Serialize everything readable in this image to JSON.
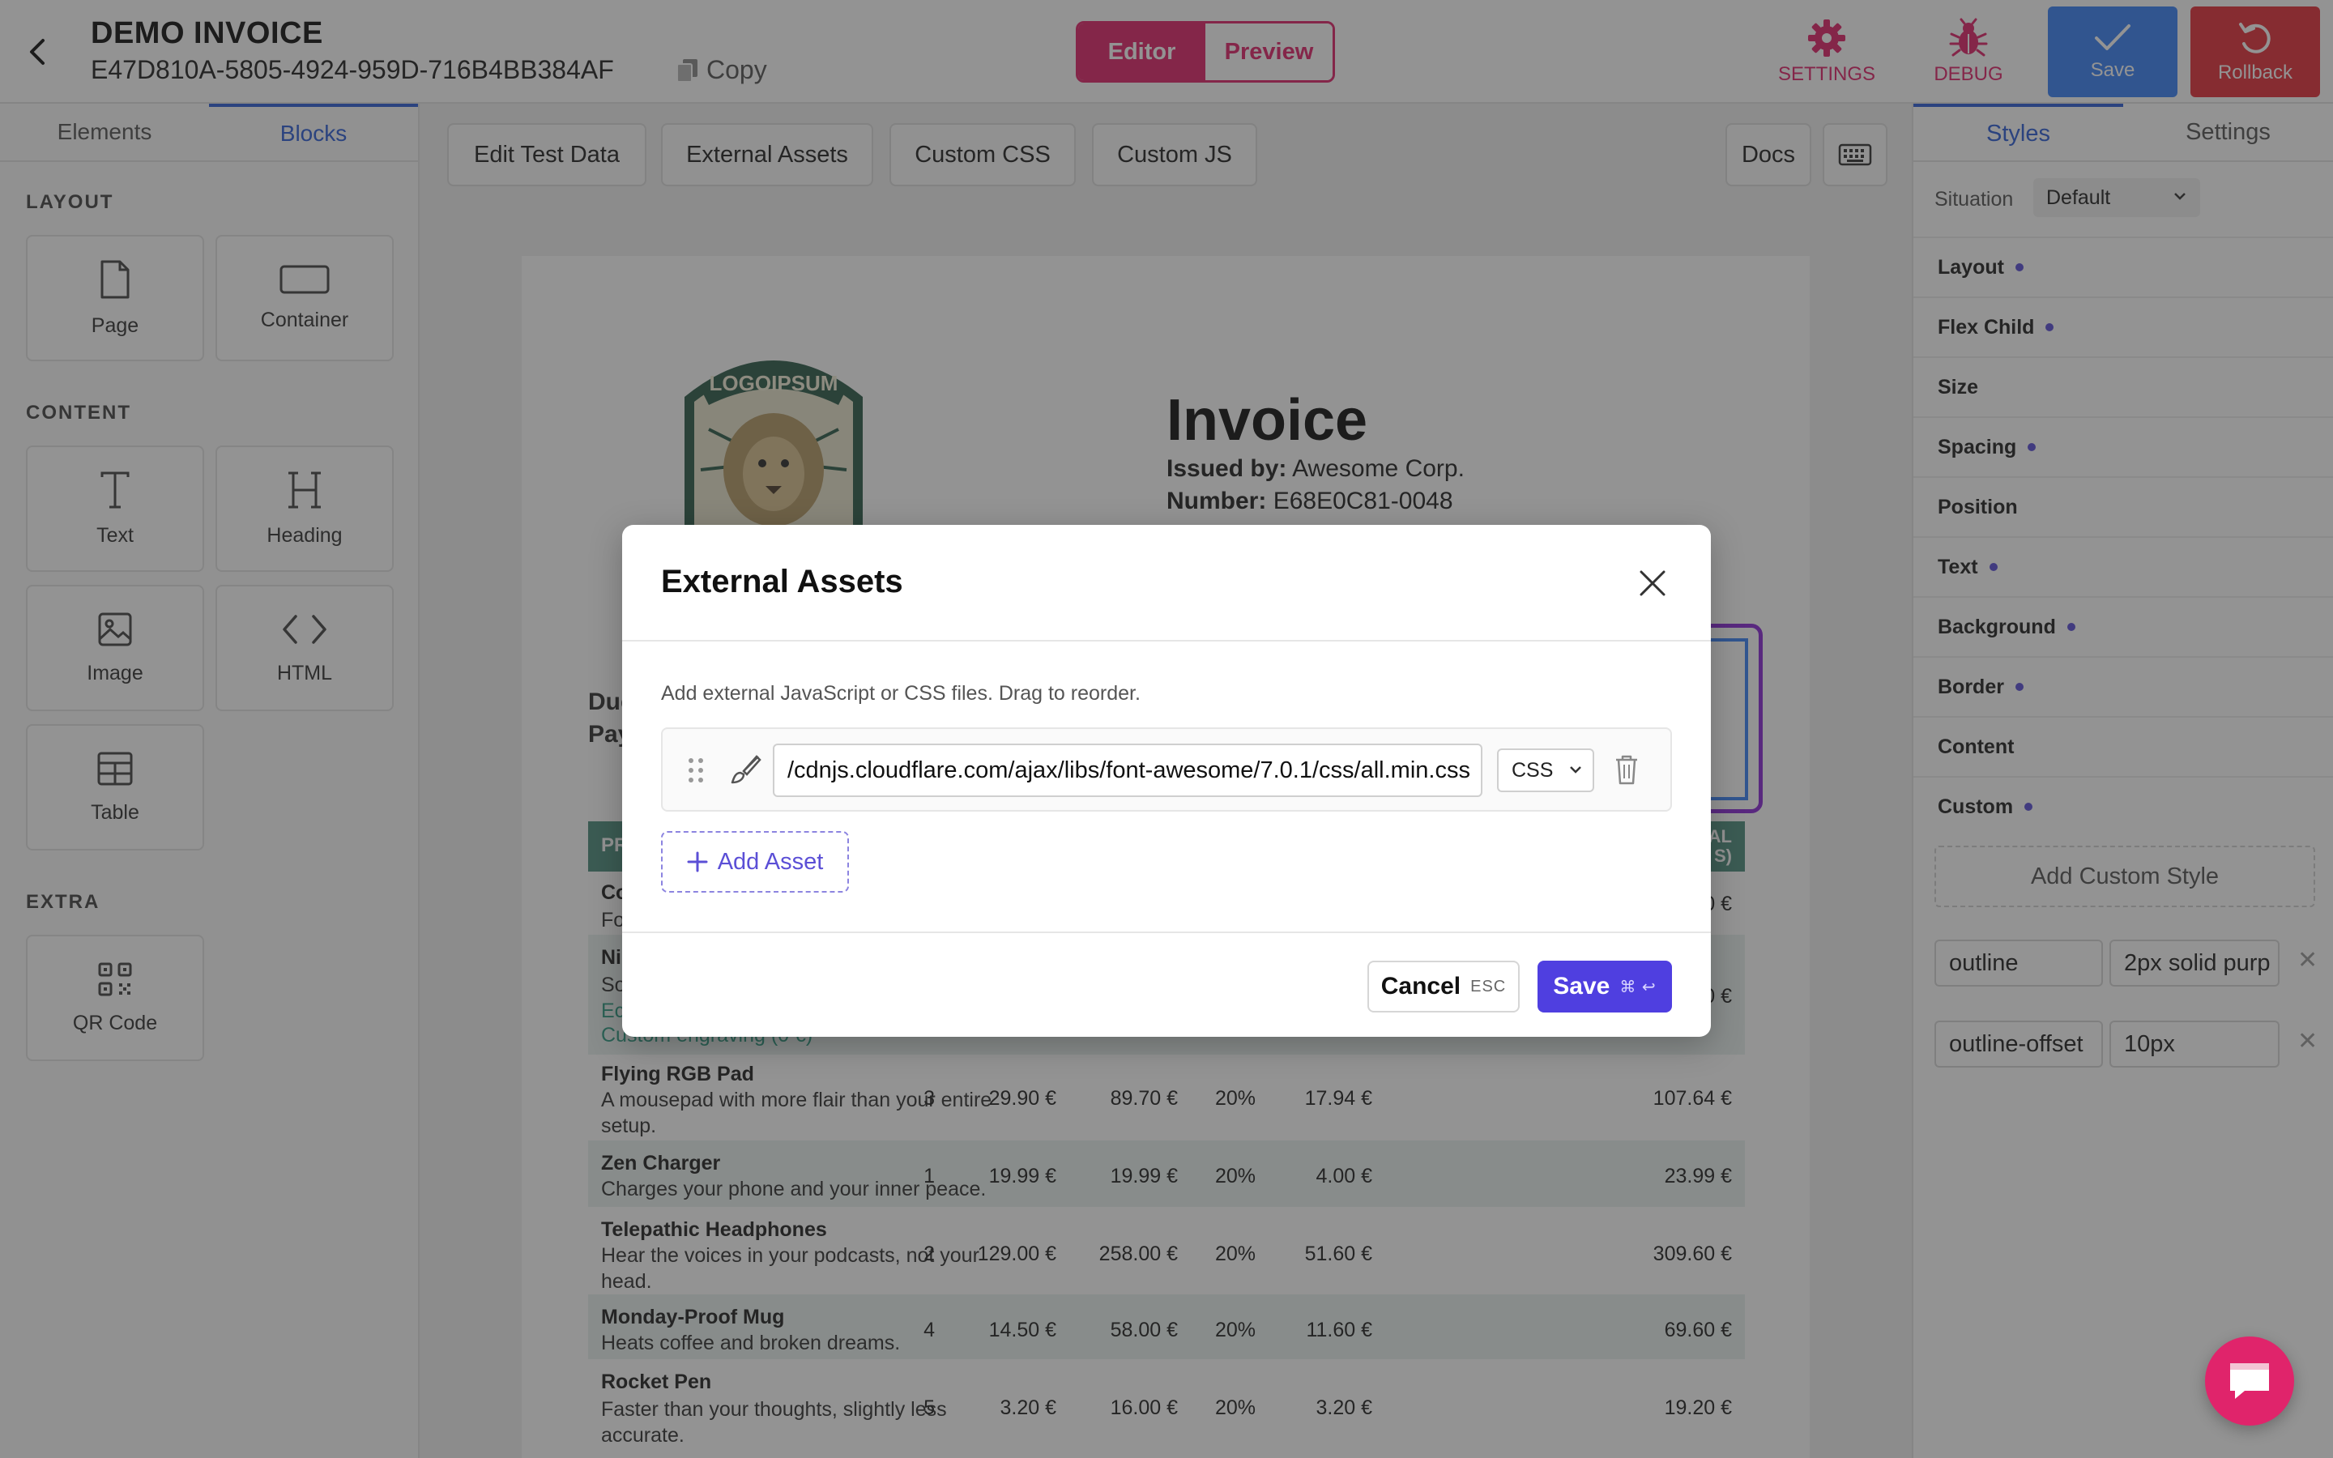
{
  "header": {
    "title": "DEMO INVOICE",
    "document_id": "E47D810A-5805-4924-959D-716B4BB384AF",
    "copy_label": "Copy",
    "modes": {
      "editor": "Editor",
      "preview": "Preview",
      "active": "Editor"
    },
    "actions": {
      "settings": "SETTINGS",
      "debug": "DEBUG",
      "save": "Save",
      "rollback": "Rollback"
    },
    "colors": {
      "accent": "#e0246b",
      "save": "#3b82f6",
      "rollback": "#e5303a"
    }
  },
  "left_sidebar": {
    "tabs": [
      "Elements",
      "Blocks"
    ],
    "active_tab": "Blocks",
    "sections": {
      "layout": {
        "label": "LAYOUT",
        "items": [
          "Page",
          "Container"
        ]
      },
      "content": {
        "label": "CONTENT",
        "items": [
          "Text",
          "Heading",
          "Image",
          "HTML",
          "Table"
        ]
      },
      "extra": {
        "label": "EXTRA",
        "items": [
          "QR Code"
        ]
      }
    }
  },
  "toolbar": {
    "buttons": [
      "Edit Test Data",
      "External Assets",
      "Custom CSS",
      "Custom JS"
    ],
    "docs": "Docs",
    "keyboard_icon": "keyboard-icon"
  },
  "invoice": {
    "logo_text": "LOGOIPSUM",
    "title": "Invoice",
    "issued_by_label": "Issued by:",
    "issued_by": "Awesome Corp.",
    "number_label": "Number:",
    "number": "E68E0C81-0048",
    "partial": {
      "due": "Due",
      "pay": "Pay",
      "header_left": "PR",
      "header_right": "AL",
      "header_right2": "S)"
    },
    "rows": [
      {
        "name": "Flying RGB Pad",
        "desc": "A mousepad with more flair than your entire setup.",
        "qty": "3",
        "price": "29.90 €",
        "net": "89.70 €",
        "vat": "20%",
        "tax": "17.94 €",
        "total": "107.64 €"
      },
      {
        "name": "Zen Charger",
        "desc": "Charges your phone and your inner peace.",
        "qty": "1",
        "price": "19.99 €",
        "net": "19.99 €",
        "vat": "20%",
        "tax": "4.00 €",
        "total": "23.99 €"
      },
      {
        "name": "Telepathic Headphones",
        "desc": "Hear the voices in your podcasts, not your head.",
        "qty": "2",
        "price": "129.00 €",
        "net": "258.00 €",
        "vat": "20%",
        "tax": "51.60 €",
        "total": "309.60 €"
      },
      {
        "name": "Monday-Proof Mug",
        "desc": "Heats coffee and broken dreams.",
        "qty": "4",
        "price": "14.50 €",
        "net": "58.00 €",
        "vat": "20%",
        "tax": "11.60 €",
        "total": "69.60 €"
      },
      {
        "name": "Rocket Pen",
        "desc": "Faster than your thoughts, slightly less accurate.",
        "qty": "5",
        "price": "3.20 €",
        "net": "16.00 €",
        "vat": "20%",
        "tax": "3.20 €",
        "total": "19.20 €"
      }
    ],
    "partial_rows": {
      "r1": {
        "a": "Co",
        "b": "Fo",
        "total_tail": "0 €"
      },
      "r2": {
        "a": "Ni",
        "b": "So",
        "c": "Ec",
        "d": "Custom engraving (0 €)",
        "total_tail": "0 €"
      }
    }
  },
  "right_sidebar": {
    "tabs": [
      "Styles",
      "Settings"
    ],
    "active_tab": "Styles",
    "situation_label": "Situation",
    "situation_value": "Default",
    "sections": [
      {
        "label": "Layout",
        "modified": true
      },
      {
        "label": "Flex Child",
        "modified": true
      },
      {
        "label": "Size",
        "modified": false
      },
      {
        "label": "Spacing",
        "modified": true
      },
      {
        "label": "Position",
        "modified": false
      },
      {
        "label": "Text",
        "modified": true
      },
      {
        "label": "Background",
        "modified": true
      },
      {
        "label": "Border",
        "modified": true
      },
      {
        "label": "Content",
        "modified": false
      },
      {
        "label": "Custom",
        "modified": true
      }
    ],
    "add_custom_style": "Add Custom Style",
    "custom_styles": [
      {
        "property": "outline",
        "value": "2px solid purp"
      },
      {
        "property": "outline-offset",
        "value": "10px"
      }
    ]
  },
  "modal": {
    "title": "External Assets",
    "description": "Add external JavaScript or CSS files. Drag to reorder.",
    "assets": [
      {
        "url": "/cdnjs.cloudflare.com/ajax/libs/font-awesome/7.0.1/css/all.min.css",
        "type": "CSS"
      }
    ],
    "add_asset": "Add Asset",
    "cancel": "Cancel",
    "cancel_shortcut": "ESC",
    "save": "Save",
    "save_shortcut": "⌘ ↩"
  }
}
